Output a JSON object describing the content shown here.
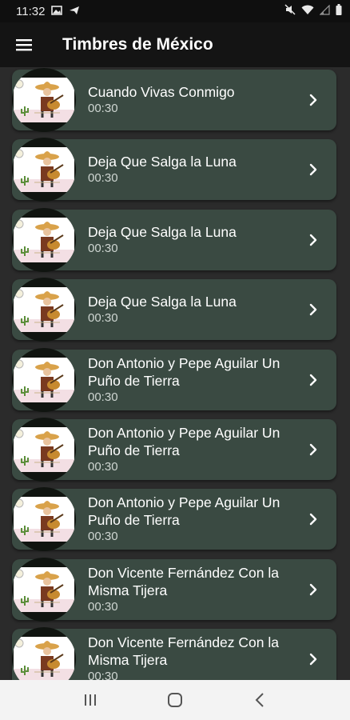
{
  "status_bar": {
    "time": "11:32",
    "left_icons": [
      "image-icon",
      "send-icon"
    ],
    "right_icons": [
      "mute-icon",
      "wifi-icon",
      "signal-icon",
      "battery-icon"
    ]
  },
  "app_bar": {
    "menu_icon": "hamburger-menu-icon",
    "title": "Timbres de México"
  },
  "ringtones": [
    {
      "title": "Cuando Vivas Conmigo",
      "duration": "00:30"
    },
    {
      "title": "Deja Que Salga la Luna",
      "duration": "00:30"
    },
    {
      "title": "Deja Que Salga la Luna",
      "duration": "00:30"
    },
    {
      "title": "Deja Que Salga la Luna",
      "duration": "00:30"
    },
    {
      "title": "Don Antonio y Pepe Aguilar Un Puño de Tierra",
      "duration": "00:30"
    },
    {
      "title": "Don Antonio y Pepe Aguilar Un Puño de Tierra",
      "duration": "00:30"
    },
    {
      "title": "Don Antonio y Pepe Aguilar Un Puño de Tierra",
      "duration": "00:30"
    },
    {
      "title": "Don Vicente Fernández   Con la Misma Tijera",
      "duration": "00:30"
    },
    {
      "title": "Don Vicente Fernández   Con la Misma Tijera",
      "duration": "00:30"
    }
  ],
  "colors": {
    "background": "#2b2b2b",
    "app_bar": "#141414",
    "card": "#3a4a42",
    "text": "#ffffff",
    "nav_bar": "#f3f3f3"
  },
  "nav_bar": {
    "icons": [
      "recent-apps-icon",
      "home-icon",
      "back-icon"
    ]
  }
}
